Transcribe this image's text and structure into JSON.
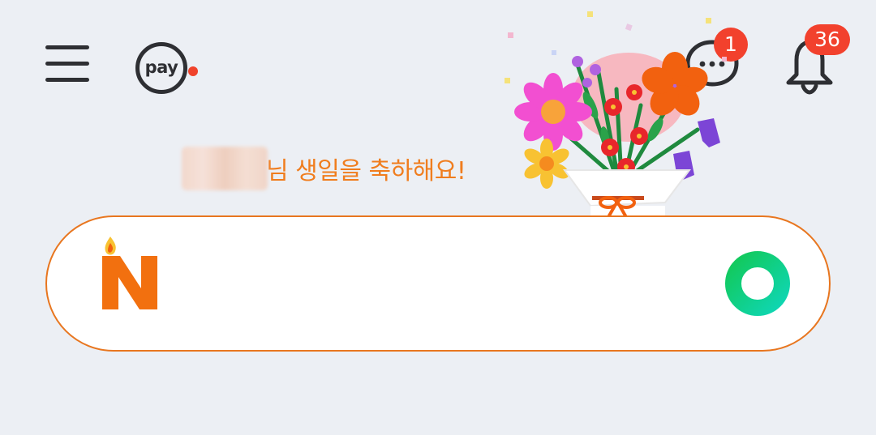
{
  "header": {
    "menu_icon": "hamburger-menu-icon",
    "pay": {
      "label": "pay",
      "has_new_dot": true
    },
    "chat": {
      "icon": "chat-bubble-icon",
      "badge": "1"
    },
    "notifications": {
      "icon": "bell-icon",
      "badge": "36"
    }
  },
  "greeting": {
    "name_hidden": true,
    "text": "님 생일을 축하해요!"
  },
  "search": {
    "logo": "naver-n-birthday-candle-logo",
    "value": "",
    "placeholder": "",
    "action_icon": "green-circle-search-icon"
  },
  "colors": {
    "background": "#eceff4",
    "accent_orange": "#f07d1e",
    "badge_red": "#f2412d",
    "naver_green": "#03c75a"
  }
}
